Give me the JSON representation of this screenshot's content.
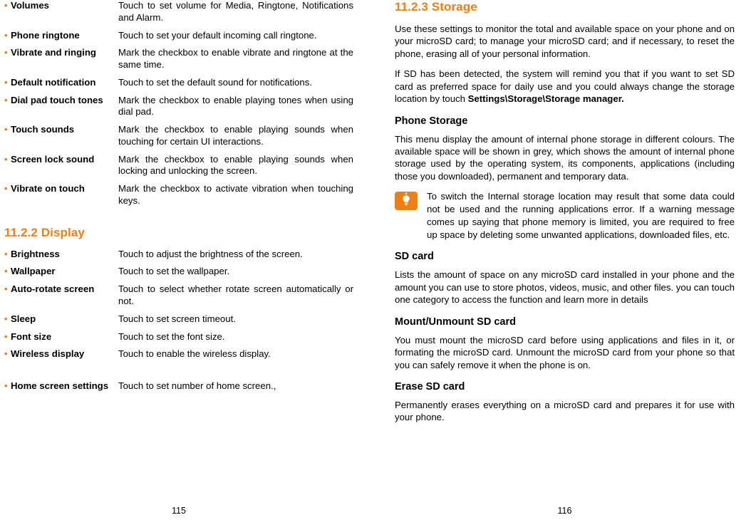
{
  "left_page": {
    "page_number": "115",
    "sound_settings": [
      {
        "term": "Volumes",
        "desc": "Touch to set volume for Media, Ringtone, Notifications and Alarm."
      },
      {
        "term": "Phone ringtone",
        "desc": "Touch to set your default incoming call ringtone."
      },
      {
        "term": "Vibrate and ringing",
        "desc": "Mark the checkbox to enable vibrate and ringtone at the same time."
      },
      {
        "term": "Default notification",
        "desc": "Touch to set the default sound for notifications."
      },
      {
        "term": "Dial pad touch tones",
        "desc": "Mark the checkbox to enable playing tones when using dial pad."
      },
      {
        "term": "Touch sounds",
        "desc": "Mark the checkbox to enable playing sounds when touching for certain UI interactions."
      },
      {
        "term": "Screen lock sound",
        "desc": "Mark the checkbox to enable playing sounds when locking and unlocking the screen."
      },
      {
        "term": "Vibrate on touch",
        "desc": "Mark the checkbox to activate vibration when touching keys."
      }
    ],
    "display_heading": {
      "number": "11.2.2",
      "title": "Display"
    },
    "display_settings": [
      {
        "term": "Brightness",
        "desc": "Touch to adjust the brightness of the screen."
      },
      {
        "term": "Wallpaper",
        "desc": "Touch to set the wallpaper."
      },
      {
        "term": "Auto-rotate screen",
        "desc": "Touch to select whether rotate screen automatically or not."
      },
      {
        "term": "Sleep",
        "desc": "Touch to set screen timeout."
      },
      {
        "term": "Font size",
        "desc": "Touch to set the font size."
      },
      {
        "term": "Wireless display",
        "desc": "Touch to enable the wireless display."
      },
      {
        "term": "Home screen settings",
        "desc": "Touch to set number of home screen.,"
      }
    ]
  },
  "right_page": {
    "page_number": "116",
    "storage_heading": {
      "number": "11.2.3",
      "title": "Storage"
    },
    "intro_paragraphs": [
      "Use these settings to monitor the total and available space on your phone and on your microSD card; to manage your microSD card; and if necessary, to reset the phone, erasing all of your personal information."
    ],
    "sd_detected_prefix": "If SD has been detected, the system will remind you that if you want to set SD card as preferred space for daily use and you could always change the storage location by touch ",
    "sd_detected_bold": "Settings\\Storage\\Storage manager.",
    "phone_storage": {
      "heading": "Phone Storage",
      "body": "This menu display the amount of internal phone storage in different colours. The available space will be shown in grey, which shows the amount of internal phone storage used by the operating system, its components, applications (including those you downloaded), permanent and temporary data."
    },
    "note": {
      "icon": "light-bulb-icon",
      "text": "To switch the Internal storage location may result that some data could not be used and the running applications error. If a warning message comes up saying that phone memory is limited, you are required to free up space by deleting some unwanted applications, downloaded files, etc."
    },
    "sd_card": {
      "heading": "SD card",
      "body": "Lists the amount of space on any microSD card installed in your phone and the amount you can use to store photos, videos, music, and other files. you can touch one category to access the function and learn more in details"
    },
    "mount_unmount": {
      "heading": "Mount/Unmount SD card",
      "body": "You must mount the microSD card before using applications and files in it, or formating the microSD card. Unmount the microSD card from your phone so that you can safely remove it when the phone is on."
    },
    "erase_sd": {
      "heading": "Erase SD card",
      "body": "Permanently erases everything on a microSD card and prepares it for use with your phone."
    }
  },
  "colors": {
    "accent": "#f07f13",
    "text": "#000000",
    "background": "#ffffff"
  }
}
